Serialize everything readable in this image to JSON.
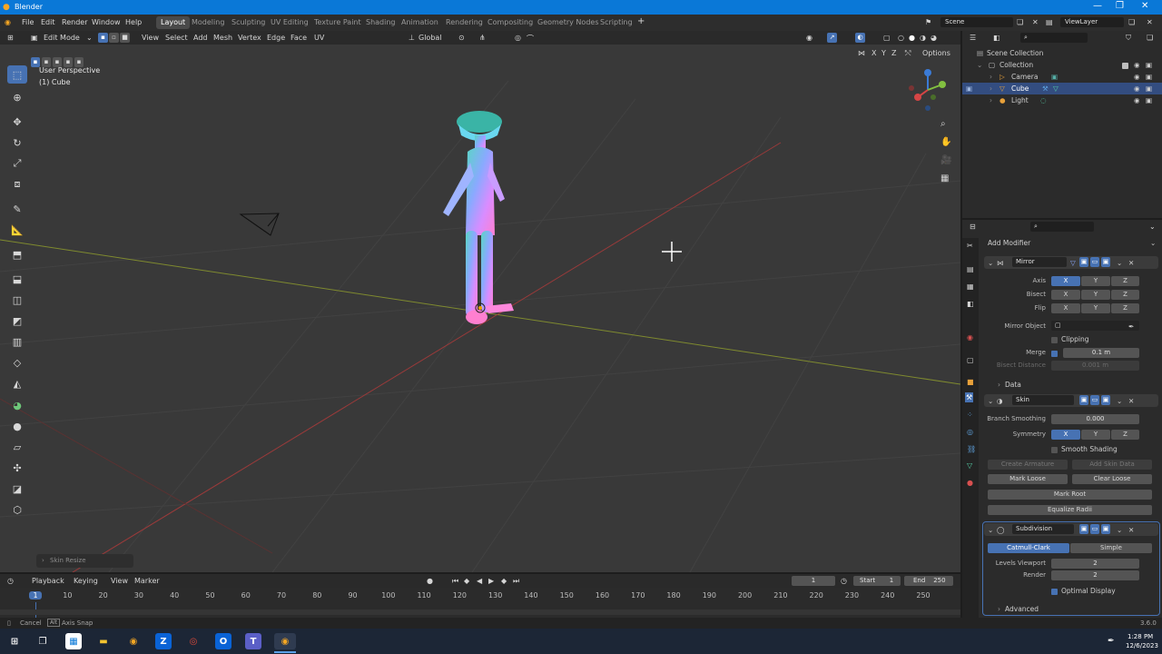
{
  "window": {
    "title": "Blender"
  },
  "menu": {
    "file": "File",
    "edit": "Edit",
    "render": "Render",
    "window": "Window",
    "help": "Help"
  },
  "workspaces": [
    "Layout",
    "Modeling",
    "Sculpting",
    "UV Editing",
    "Texture Paint",
    "Shading",
    "Animation",
    "Rendering",
    "Compositing",
    "Geometry Nodes",
    "Scripting"
  ],
  "active_workspace": "Layout",
  "scene": {
    "name": "Scene",
    "view_layer": "ViewLayer"
  },
  "viewport_header": {
    "mode": "Edit Mode",
    "view": "View",
    "select": "Select",
    "add": "Add",
    "mesh": "Mesh",
    "vertex": "Vertex",
    "edge": "Edge",
    "face": "Face",
    "uv": "UV",
    "orientation": "Global",
    "options": "Options",
    "axes": [
      "X",
      "Y",
      "Z"
    ]
  },
  "viewport": {
    "perspective": "User Perspective",
    "object": "(1) Cube",
    "last_op": "Skin Resize"
  },
  "outliner": {
    "root": "Scene Collection",
    "collection": "Collection",
    "items": [
      "Camera",
      "Cube",
      "Light"
    ],
    "selected": "Cube"
  },
  "properties": {
    "add_modifier": "Add Modifier",
    "mirror": {
      "name": "Mirror",
      "axis_label": "Axis",
      "bisect_label": "Bisect",
      "flip_label": "Flip",
      "xyz": [
        "X",
        "Y",
        "Z"
      ],
      "mirror_object_label": "Mirror Object",
      "clipping": "Clipping",
      "merge_label": "Merge",
      "merge_value": "0.1 m",
      "bisect_distance_label": "Bisect Distance",
      "bisect_distance_value": "0.001 m",
      "data": "Data"
    },
    "skin": {
      "name": "Skin",
      "branch_smoothing_label": "Branch Smoothing",
      "branch_smoothing_value": "0.000",
      "symmetry_label": "Symmetry",
      "smooth_shading": "Smooth Shading",
      "create_armature": "Create Armature",
      "add_skin_data": "Add Skin Data",
      "mark_loose": "Mark Loose",
      "clear_loose": "Clear Loose",
      "mark_root": "Mark Root",
      "equalize_radii": "Equalize Radii"
    },
    "subdivision": {
      "name": "Subdivision",
      "catmull": "Catmull-Clark",
      "simple": "Simple",
      "levels_viewport_label": "Levels Viewport",
      "levels_viewport": "2",
      "render_label": "Render",
      "render": "2",
      "optimal_display": "Optimal Display",
      "advanced": "Advanced"
    }
  },
  "timeline": {
    "playback": "Playback",
    "keying": "Keying",
    "view": "View",
    "marker": "Marker",
    "current_frame": "1",
    "start_label": "Start",
    "start": "1",
    "end_label": "End",
    "end": "250",
    "ticks": [
      "1",
      "10",
      "20",
      "30",
      "40",
      "50",
      "60",
      "70",
      "80",
      "90",
      "100",
      "110",
      "120",
      "130",
      "140",
      "150",
      "160",
      "170",
      "180",
      "190",
      "200",
      "210",
      "220",
      "230",
      "240",
      "250"
    ]
  },
  "status": {
    "cancel": "Cancel",
    "alt": "Alt",
    "axis_snap": "Axis Snap",
    "version": "3.6.0"
  },
  "taskbar": {
    "time": "1:28 PM",
    "date": "12/6/2023"
  }
}
